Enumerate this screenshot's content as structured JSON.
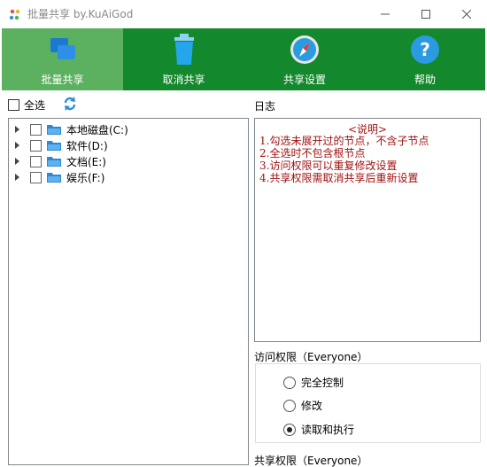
{
  "window": {
    "title": "批量共享 by.KuAiGod",
    "minimize_glyph": "—",
    "maximize_glyph": "☐",
    "close_glyph": "✕"
  },
  "toolbar": {
    "items": [
      {
        "label": "批量共享",
        "icon": "share-windows-icon",
        "active": true
      },
      {
        "label": "取消共享",
        "icon": "trash-icon",
        "active": false
      },
      {
        "label": "共享设置",
        "icon": "compass-icon",
        "active": false
      },
      {
        "label": "帮助",
        "icon": "help-icon",
        "active": false
      }
    ]
  },
  "left": {
    "select_all_label": "全选",
    "tree": [
      {
        "label": "本地磁盘(C:)"
      },
      {
        "label": "软件(D:)"
      },
      {
        "label": "文档(E:)"
      },
      {
        "label": "娱乐(F:)"
      }
    ]
  },
  "log": {
    "title": "日志",
    "heading": "<说明>",
    "lines": [
      "1.勾选未展开过的节点，不含子节点",
      "2.全选时不包含根节点",
      "3.访问权限可以重复修改设置",
      "4.共享权限需取消共享后重新设置"
    ]
  },
  "access": {
    "title": "访问权限（Everyone）",
    "options": [
      {
        "label": "完全控制",
        "checked": false
      },
      {
        "label": "修改",
        "checked": false
      },
      {
        "label": "读取和执行",
        "checked": true
      }
    ]
  },
  "share": {
    "title": "共享权限（Everyone）"
  },
  "colors": {
    "toolbar_bg": "#14882d",
    "toolbar_active": "#5cb161",
    "log_text": "#a01010"
  }
}
